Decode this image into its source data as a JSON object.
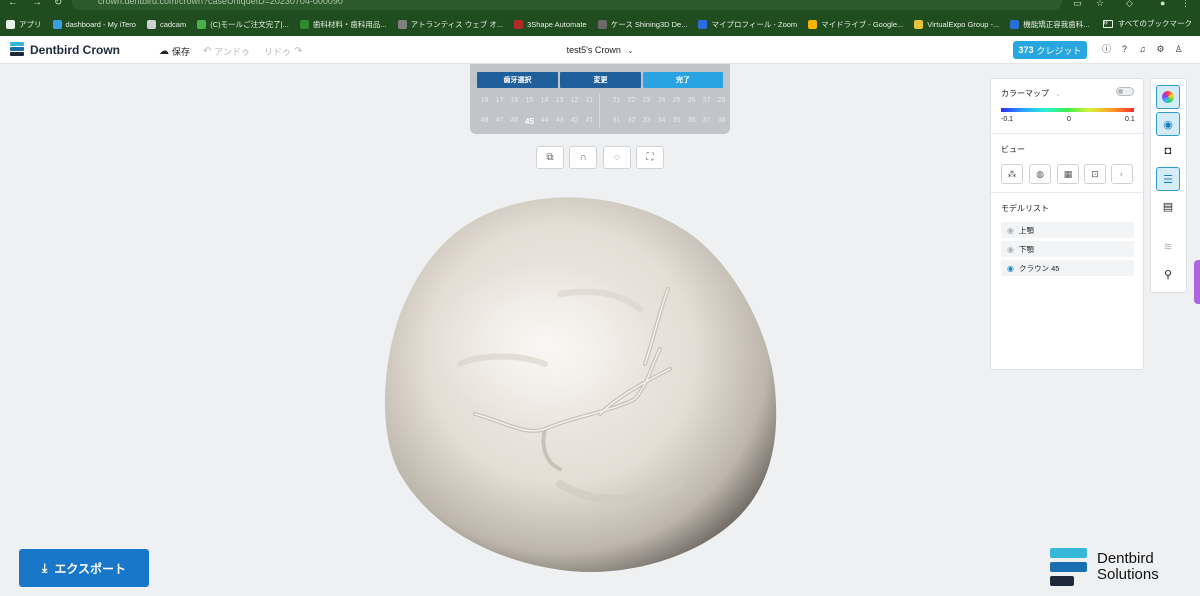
{
  "browser": {
    "url": "crown.dentbird.com/crown?caseUniqueID=20230704-000090",
    "bookmarks": [
      {
        "label": "アプリ",
        "color": "#e8f1e8"
      },
      {
        "label": "dashboard - My iTero",
        "color": "#3aa0e0"
      },
      {
        "label": "cadcam",
        "color": "#d0d0d0"
      },
      {
        "label": "(C)モールご注文完了|...",
        "color": "#4ab04a"
      },
      {
        "label": "歯科材料・歯科用品...",
        "color": "#2d8a2d"
      },
      {
        "label": "アトランティス ウェブ オ...",
        "color": "#808080"
      },
      {
        "label": "3Shape Automate",
        "color": "#b02a2a"
      },
      {
        "label": "ケース Shining3D De...",
        "color": "#6a6a6a"
      },
      {
        "label": "マイプロフィール - Zoom",
        "color": "#2d6be0"
      },
      {
        "label": "マイドライブ - Google...",
        "color": "#f4b400"
      },
      {
        "label": "VirtualExpo Group -...",
        "color": "#e8c23a"
      },
      {
        "label": "機能矯正容我歯科...",
        "color": "#2a6fd6"
      }
    ],
    "more_label": "»",
    "all_bookmarks_label": "すべてのブックマーク"
  },
  "header": {
    "app_name": "Dentbird Crown",
    "save_label": "保存",
    "undo_label": "アンドゥ",
    "redo_label": "リドゥ",
    "case_title": "test5's Crown",
    "credits_count": "373",
    "credits_label": "クレジット"
  },
  "tooth_selector": {
    "buttons": [
      "歯牙選択",
      "変更",
      "完了"
    ],
    "upper_row_left": [
      "18",
      "17",
      "16",
      "15",
      "14",
      "13",
      "12",
      "11"
    ],
    "upper_row_right": [
      "21",
      "22",
      "23",
      "24",
      "25",
      "26",
      "27",
      "28"
    ],
    "lower_row_left": [
      "48",
      "47",
      "46",
      "45",
      "44",
      "43",
      "42",
      "41"
    ],
    "lower_row_right": [
      "31",
      "32",
      "33",
      "34",
      "35",
      "36",
      "37",
      "38"
    ],
    "selected_tooth": "45"
  },
  "right_panel": {
    "colormap_label": "カラーマップ",
    "scale_min": "-0.1",
    "scale_mid": "0",
    "scale_max": "0.1",
    "view_label": "ビュー",
    "model_list_label": "モデルリスト",
    "models": [
      {
        "label": "上顎",
        "visible": false
      },
      {
        "label": "下顎",
        "visible": false
      },
      {
        "label": "クラウン 45",
        "visible": true
      }
    ]
  },
  "export_label": "エクスポート",
  "brand": {
    "line1": "Dentbird",
    "line2": "Solutions"
  },
  "colors": {
    "accent_blue": "#1877c9",
    "credits_blue": "#27a6e0",
    "tooth_panel": "#c1c5ca",
    "crown_surface": "#e7e2da"
  }
}
